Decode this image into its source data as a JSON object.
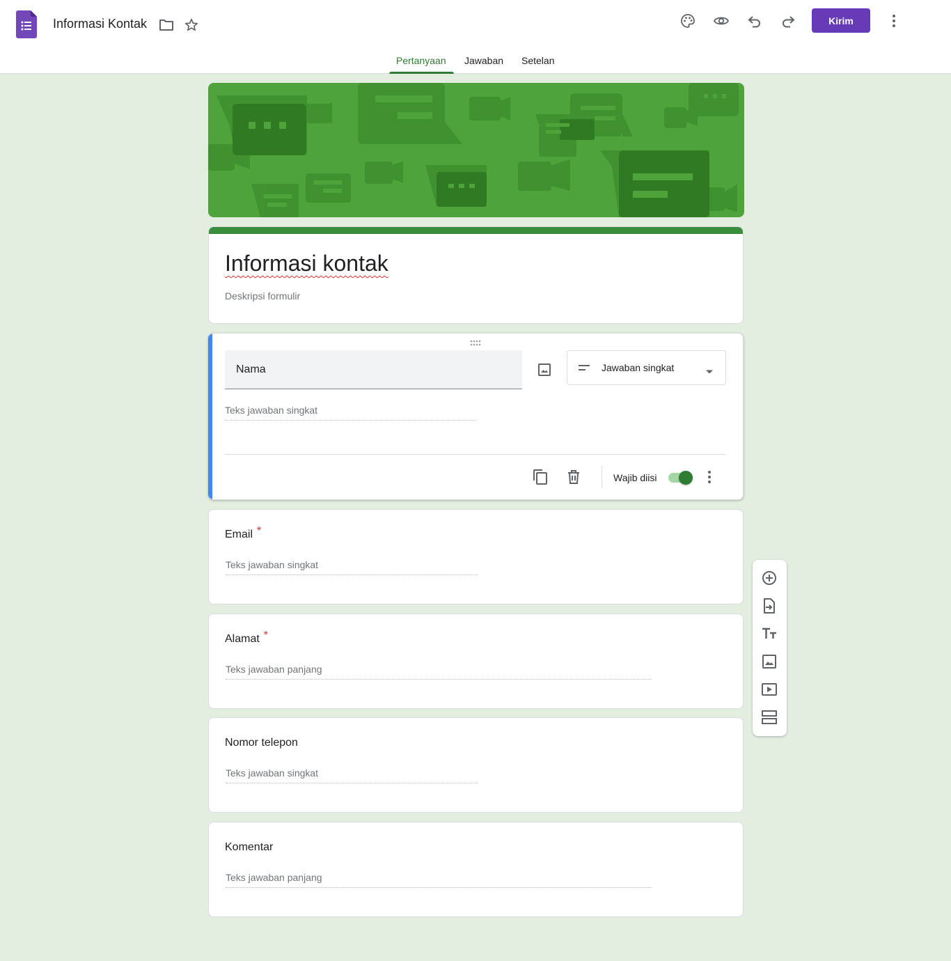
{
  "header": {
    "doc_title": "Informasi Kontak",
    "send_label": "Kirim",
    "icons": [
      "forms-app-icon",
      "folder-icon",
      "star-icon",
      "palette-icon",
      "eye-icon",
      "undo-icon",
      "redo-icon",
      "more-vert-icon"
    ]
  },
  "tabs": [
    {
      "label": "Pertanyaan",
      "active": true
    },
    {
      "label": "Jawaban",
      "active": false
    },
    {
      "label": "Setelan",
      "active": false
    }
  ],
  "form": {
    "title": "Informasi kontak",
    "description_placeholder": "Deskripsi formulir"
  },
  "active_question": {
    "title": "Nama",
    "type_label": "Jawaban singkat",
    "answer_placeholder": "Teks jawaban singkat",
    "required_label": "Wajib diisi",
    "required": true
  },
  "questions": [
    {
      "title": "Email",
      "required_mark": "*",
      "answer_placeholder": "Teks jawaban singkat"
    },
    {
      "title": "Alamat",
      "required_mark": "*",
      "answer_placeholder": "Teks jawaban panjang"
    },
    {
      "title": "Nomor telepon",
      "required_mark": "",
      "answer_placeholder": "Teks jawaban singkat"
    },
    {
      "title": "Komentar",
      "required_mark": "",
      "answer_placeholder": "Teks jawaban panjang"
    }
  ],
  "toolbar": {
    "icons": [
      "add-question-icon",
      "import-questions-icon",
      "add-title-icon",
      "add-image-icon",
      "add-video-icon",
      "add-section-icon"
    ]
  },
  "colors": {
    "accent": "#673ab7",
    "theme_green": "#2e7d32",
    "banner_green": "#4ea43b",
    "active_bar": "#4285f4",
    "background": "#e3ede0",
    "required_red": "#d93025"
  }
}
